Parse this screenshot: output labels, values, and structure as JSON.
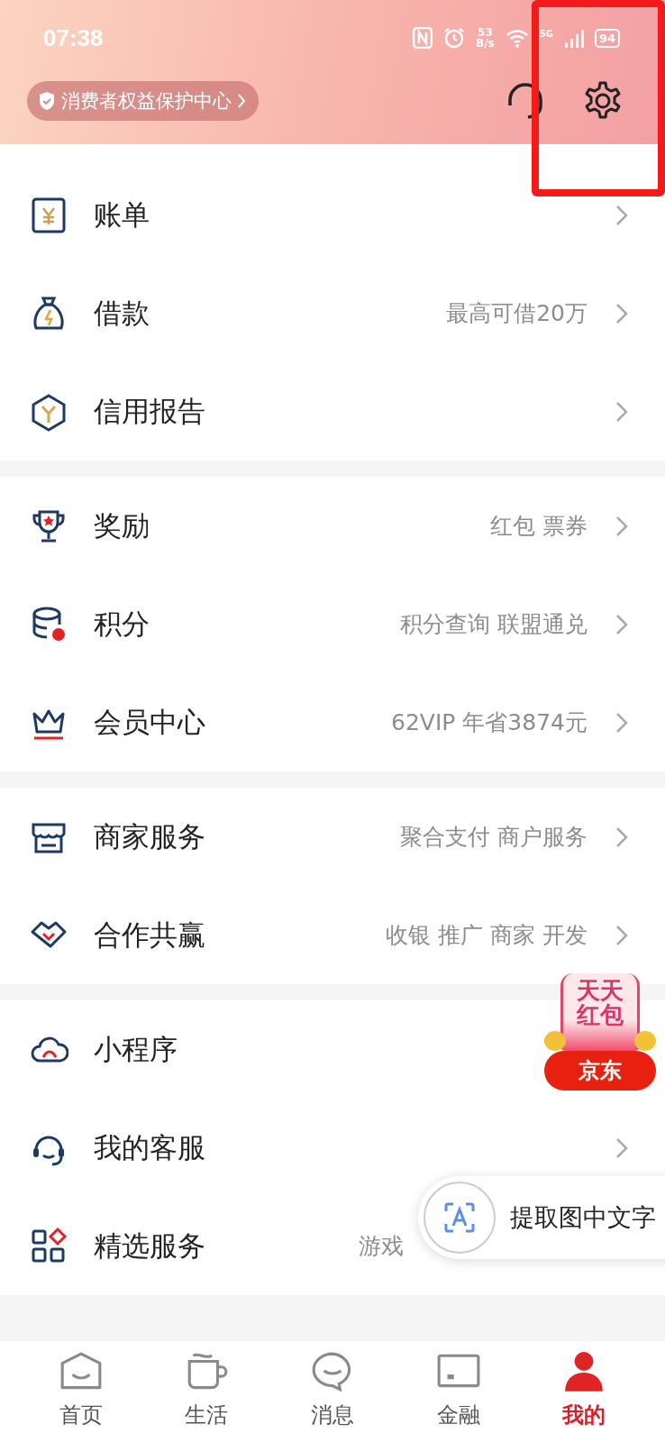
{
  "status_bar": {
    "time": "07:38",
    "net_speed": "53",
    "net_unit": "B/s",
    "network": "5G",
    "battery": "94"
  },
  "header": {
    "protection_link": "消费者权益保护中心"
  },
  "sections": [
    {
      "items": [
        {
          "label": "账单",
          "chevron": true
        },
        {
          "label": "借款",
          "detail": "最高可借20万",
          "chevron": true
        },
        {
          "label": "信用报告",
          "chevron": true
        }
      ]
    },
    {
      "items": [
        {
          "label": "奖励",
          "detail": "红包 票券",
          "chevron": true
        },
        {
          "label": "积分",
          "detail": "积分查询 联盟通兑",
          "chevron": true
        },
        {
          "label": "会员中心",
          "detail": "62VIP 年省3874元",
          "chevron": true
        }
      ]
    },
    {
      "items": [
        {
          "label": "商家服务",
          "detail": "聚合支付 商户服务",
          "chevron": true
        },
        {
          "label": "合作共赢",
          "detail": "收银 推广 商家 开发",
          "chevron": true
        }
      ]
    },
    {
      "items": [
        {
          "label": "小程序",
          "chevron": false
        },
        {
          "label": "我的客服",
          "chevron": true
        },
        {
          "label": "精选服务",
          "detail": "游戏",
          "chevron": false
        }
      ]
    }
  ],
  "promo_badge": {
    "title": "天天红包",
    "brand": "京东"
  },
  "ocr_button": {
    "label": "提取图中文字"
  },
  "highlight_frame": true,
  "tabs": [
    {
      "label": "首页",
      "selected": false
    },
    {
      "label": "生活",
      "selected": false
    },
    {
      "label": "消息",
      "selected": false
    },
    {
      "label": "金融",
      "selected": false
    },
    {
      "label": "我的",
      "selected": true
    }
  ]
}
